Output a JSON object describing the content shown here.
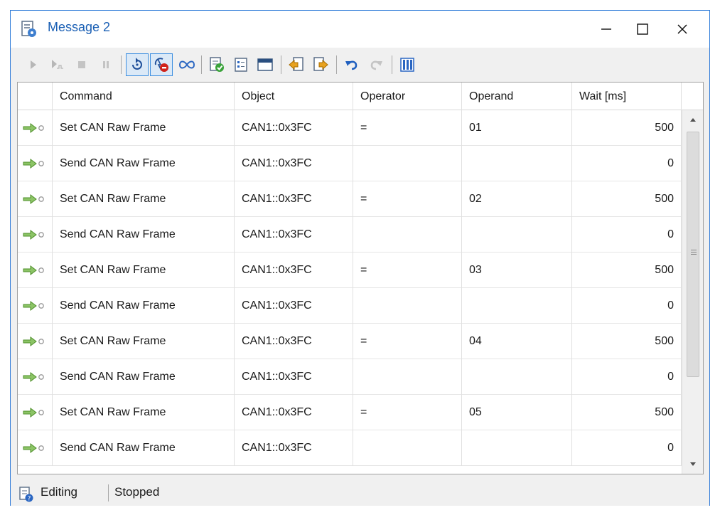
{
  "window": {
    "title": "Message 2"
  },
  "columns": [
    "Command",
    "Object",
    "Operator",
    "Operand",
    "Wait [ms]"
  ],
  "rows": [
    {
      "command": "Set CAN Raw Frame",
      "object": "CAN1::0x3FC",
      "operator": "=",
      "operand": "01",
      "wait": "500"
    },
    {
      "command": "Send CAN Raw Frame",
      "object": "CAN1::0x3FC",
      "operator": "",
      "operand": "",
      "wait": "0"
    },
    {
      "command": "Set CAN Raw Frame",
      "object": "CAN1::0x3FC",
      "operator": "=",
      "operand": "02",
      "wait": "500"
    },
    {
      "command": "Send CAN Raw Frame",
      "object": "CAN1::0x3FC",
      "operator": "",
      "operand": "",
      "wait": "0"
    },
    {
      "command": "Set CAN Raw Frame",
      "object": "CAN1::0x3FC",
      "operator": "=",
      "operand": "03",
      "wait": "500"
    },
    {
      "command": "Send CAN Raw Frame",
      "object": "CAN1::0x3FC",
      "operator": "",
      "operand": "",
      "wait": "0"
    },
    {
      "command": "Set CAN Raw Frame",
      "object": "CAN1::0x3FC",
      "operator": "=",
      "operand": "04",
      "wait": "500"
    },
    {
      "command": "Send CAN Raw Frame",
      "object": "CAN1::0x3FC",
      "operator": "",
      "operand": "",
      "wait": "0"
    },
    {
      "command": "Set CAN Raw Frame",
      "object": "CAN1::0x3FC",
      "operator": "=",
      "operand": "05",
      "wait": "500"
    },
    {
      "command": "Send CAN Raw Frame",
      "object": "CAN1::0x3FC",
      "operator": "",
      "operand": "",
      "wait": "0"
    }
  ],
  "status": {
    "mode": "Editing",
    "state": "Stopped"
  },
  "toolbar_icons": [
    "play-icon",
    "step-icon",
    "stop-icon",
    "pause-icon",
    "loop-once-icon",
    "loop-stop-icon",
    "infinite-loop-icon",
    "check-icon",
    "list-icon",
    "window-icon",
    "import-icon",
    "export-icon",
    "undo-icon",
    "redo-icon",
    "columns-icon"
  ],
  "colors": {
    "accent": "#2b79d8",
    "title": "#1a5fb4",
    "arrow": "#5aa02c"
  }
}
